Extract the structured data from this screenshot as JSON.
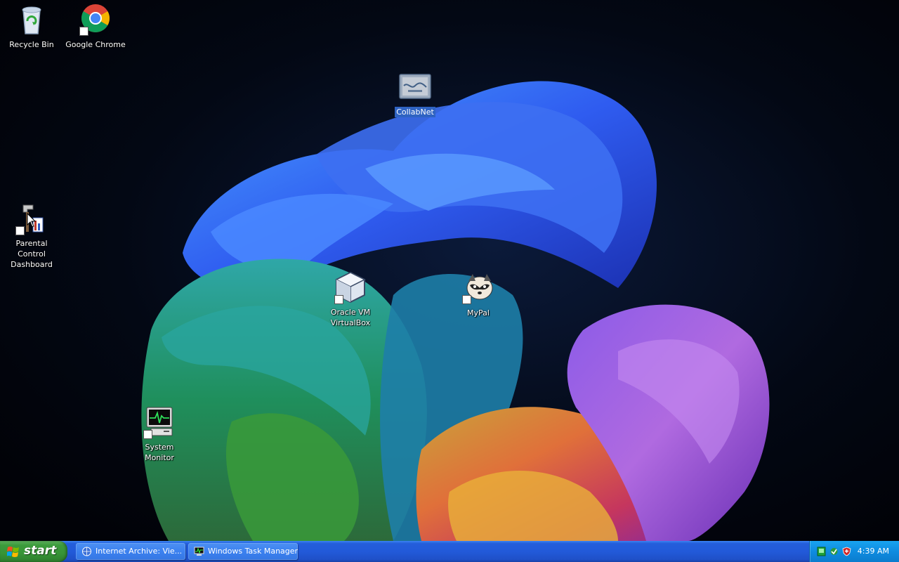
{
  "desktop": {
    "icons": [
      {
        "id": "recycle-bin",
        "label": "Recycle Bin"
      },
      {
        "id": "google-chrome",
        "label": "Google Chrome"
      },
      {
        "id": "collabnet",
        "label": "CollabNet",
        "selected": true
      },
      {
        "id": "parental-control",
        "label": "Parental Control Dashboard",
        "line1": "Parental Control",
        "line2": "Dashboard"
      },
      {
        "id": "virtualbox",
        "label": "Oracle VM VirtualBox",
        "line1": "Oracle VM",
        "line2": "VirtualBox"
      },
      {
        "id": "mypal",
        "label": "MyPal"
      },
      {
        "id": "system-monitor",
        "label": "System Monitor"
      }
    ]
  },
  "taskbar": {
    "start_label": "start",
    "tasks": [
      {
        "label": "Internet Archive: Vie...",
        "icon": "globe-icon"
      },
      {
        "label": "Windows Task Manager",
        "icon": "task-manager-icon"
      }
    ],
    "tray": {
      "icons": [
        "network-icon",
        "update-icon",
        "security-shield-icon"
      ],
      "clock": "4:39 AM"
    }
  },
  "colors": {
    "taskbar": "#245edb",
    "start_button": "#3c9b3c",
    "tray": "#0f8ce0",
    "selection": "#2f63c2"
  }
}
